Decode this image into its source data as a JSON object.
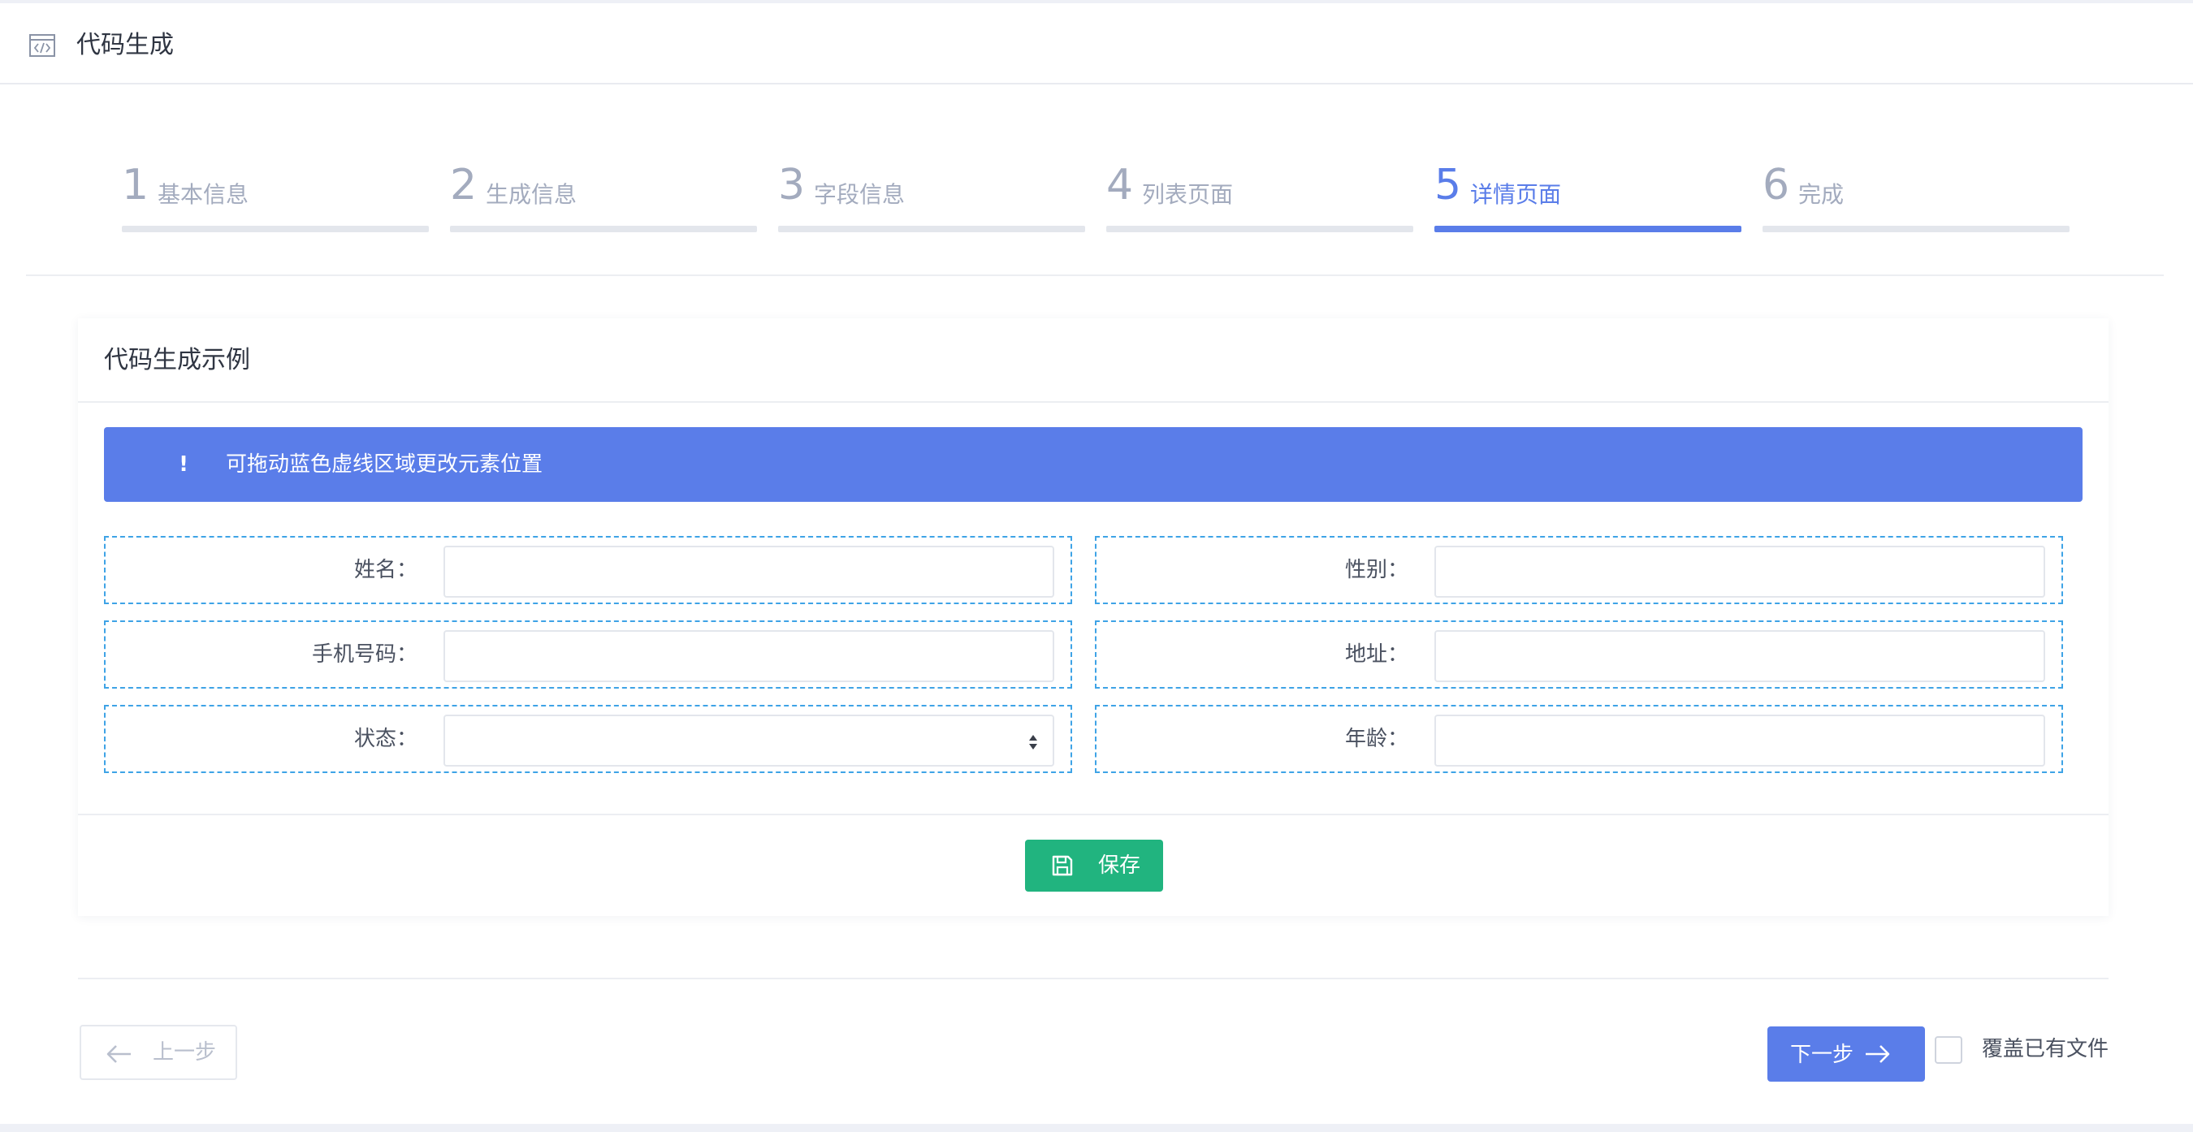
{
  "header": {
    "title": "代码生成",
    "icon": "code-window-icon"
  },
  "steps": [
    {
      "number": "1",
      "label": "基本信息",
      "active": false
    },
    {
      "number": "2",
      "label": "生成信息",
      "active": false
    },
    {
      "number": "3",
      "label": "字段信息",
      "active": false
    },
    {
      "number": "4",
      "label": "列表页面",
      "active": false
    },
    {
      "number": "5",
      "label": "详情页面",
      "active": true
    },
    {
      "number": "6",
      "label": "完成",
      "active": false
    }
  ],
  "card": {
    "title": "代码生成示例",
    "alert": {
      "icon": "!",
      "text": "可拖动蓝色虚线区域更改元素位置"
    },
    "fields": [
      {
        "label": "姓名：",
        "value": "",
        "type": "text"
      },
      {
        "label": "性别：",
        "value": "",
        "type": "text"
      },
      {
        "label": "手机号码：",
        "value": "",
        "type": "text"
      },
      {
        "label": "地址：",
        "value": "",
        "type": "text"
      },
      {
        "label": "状态：",
        "value": "",
        "type": "select"
      },
      {
        "label": "年龄：",
        "value": "",
        "type": "text"
      }
    ],
    "save_label": "保存"
  },
  "footer": {
    "prev_label": "上一步",
    "next_label": "下一步",
    "overwrite_label": "覆盖已有文件",
    "overwrite_checked": false
  },
  "colors": {
    "primary": "#5a7de9",
    "success": "#21b47f",
    "dashed_border": "#3ea3e6",
    "inactive_step": "#a3abbe"
  }
}
